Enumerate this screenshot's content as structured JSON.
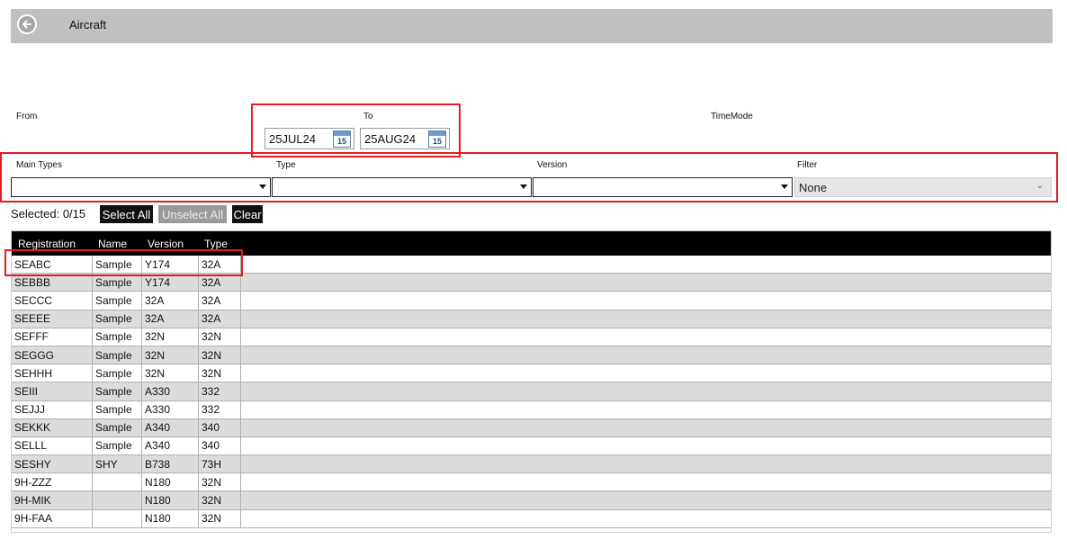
{
  "header": {
    "title": "Aircraft"
  },
  "dates": {
    "from_label": "From",
    "to_label": "To",
    "timemode_label": "TimeMode",
    "from_value": "25JUL24",
    "to_value": "25AUG24",
    "calendar_day": "15"
  },
  "filters": {
    "main_types_label": "Main Types",
    "type_label": "Type",
    "version_label": "Version",
    "filter_label": "Filter",
    "filter_value": "None"
  },
  "selection": {
    "selected_text": "Selected: 0/15",
    "select_all": "Select All",
    "unselect_all": "Unselect All",
    "clear": "Clear"
  },
  "table": {
    "headers": [
      "Registration",
      "Name",
      "Version",
      "Type"
    ],
    "rows": [
      [
        "SEABC",
        "Sample",
        "Y174",
        "32A"
      ],
      [
        "SEBBB",
        "Sample",
        "Y174",
        "32A"
      ],
      [
        "SECCC",
        "Sample",
        "32A",
        "32A"
      ],
      [
        "SEEEE",
        "Sample",
        "32A",
        "32A"
      ],
      [
        "SEFFF",
        "Sample",
        "32N",
        "32N"
      ],
      [
        "SEGGG",
        "Sample",
        "32N",
        "32N"
      ],
      [
        "SEHHH",
        "Sample",
        "32N",
        "32N"
      ],
      [
        "SEIII",
        "Sample",
        "A330",
        "332"
      ],
      [
        "SEJJJ",
        "Sample",
        "A330",
        "332"
      ],
      [
        "SEKKK",
        "Sample",
        "A340",
        "340"
      ],
      [
        "SELLL",
        "Sample",
        "A340",
        "340"
      ],
      [
        "SESHY",
        "SHY",
        "B738",
        "73H"
      ],
      [
        "9H-ZZZ",
        "",
        "N180",
        "32N"
      ],
      [
        "9H-MIK",
        "",
        "N180",
        "32N"
      ],
      [
        "9H-FAA",
        "",
        "N180",
        "32N"
      ]
    ]
  },
  "colors": {
    "header_bg": "#c0c0c0",
    "highlight": "#e31b23",
    "table_header_bg": "#000000",
    "row_alt": "#dcdcdc"
  }
}
